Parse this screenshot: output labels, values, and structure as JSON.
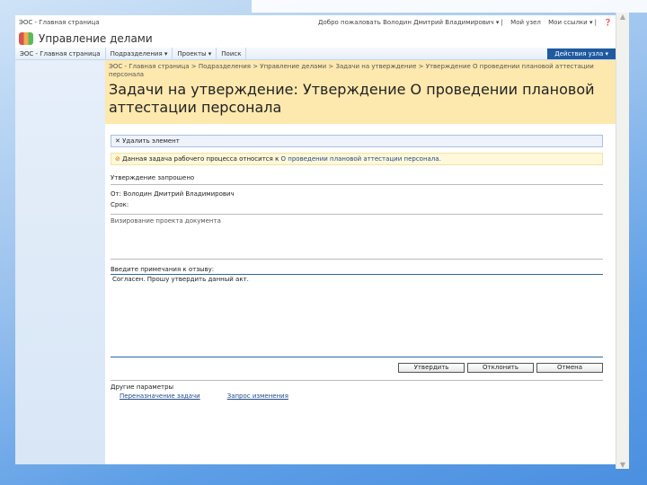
{
  "top": {
    "site": "ЭОС - Главная страница",
    "user": "Добро пожаловать Володин Дмитрий Владимирович",
    "my_site": "Мой узел",
    "my_links": "Мои ссылки"
  },
  "title": "Управление делами",
  "nav": [
    "ЭОС - Главная страница",
    "Подразделения ▾",
    "Проекты ▾",
    "Поиск"
  ],
  "site_actions": "Действия узла ▾",
  "breadcrumb": "ЭОС - Главная страница > Подразделения > Управление делами > Задачи на утверждение > Утверждение О проведении плановой аттестации персонала",
  "page_title": "Задачи на утверждение: Утверждение О проведении плановой аттестации персонала",
  "toolbar": {
    "delete": "Удалить элемент"
  },
  "info": {
    "text": "Данная задача рабочего процесса относится к ",
    "link": "О проведении плановой аттестации персонала."
  },
  "form": {
    "heading": "Утверждение запрошено",
    "from": "От: Володин Дмитрий Владимирович",
    "due": "Срок:",
    "description": "Визирование проекта документа",
    "comment_label": "Введите примечания к отзыву:",
    "comment_value": "Согласен. Прошу утвердить данный акт."
  },
  "buttons": {
    "approve": "Утвердить",
    "reject": "Отклонить",
    "cancel": "Отмена"
  },
  "other": {
    "heading": "Другие параметры",
    "reassign": "Переназначение задачи",
    "request_change": "Запрос изменения"
  }
}
